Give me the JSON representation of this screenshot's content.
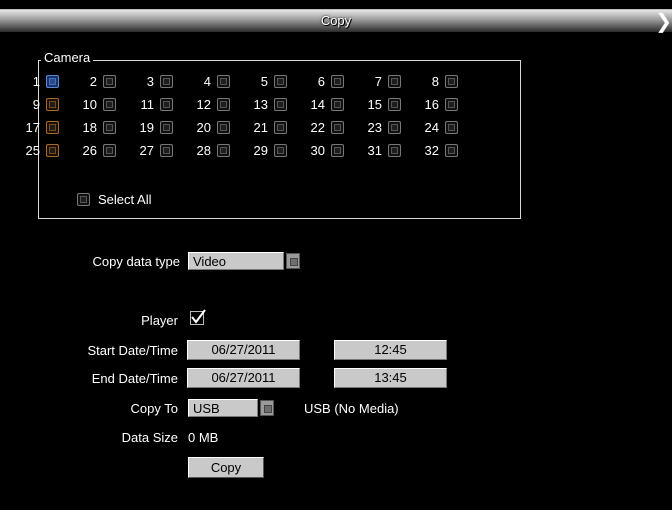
{
  "window": {
    "title": "Copy",
    "close_glyph": "❯"
  },
  "camera": {
    "legend": "Camera",
    "channels": [
      "1",
      "2",
      "3",
      "4",
      "5",
      "6",
      "7",
      "8",
      "9",
      "10",
      "11",
      "12",
      "13",
      "14",
      "15",
      "16",
      "17",
      "18",
      "19",
      "20",
      "21",
      "22",
      "23",
      "24",
      "25",
      "26",
      "27",
      "28",
      "29",
      "30",
      "31",
      "32"
    ],
    "select_all_label": "Select All"
  },
  "copy_data_type": {
    "label": "Copy data type",
    "value": "Video"
  },
  "player": {
    "label": "Player",
    "checked": true
  },
  "start": {
    "label": "Start Date/Time",
    "date": "06/27/2011",
    "time": "12:45"
  },
  "end": {
    "label": "End Date/Time",
    "date": "06/27/2011",
    "time": "13:45"
  },
  "copy_to": {
    "label": "Copy To",
    "value": "USB",
    "status": "USB (No Media)"
  },
  "data_size": {
    "label": "Data Size",
    "value": "0 MB"
  },
  "copy_button": {
    "label": "Copy"
  },
  "colors": {
    "background": "#000000",
    "field": "#c9c9c9",
    "selected_border": "#5a86d6",
    "alt_border": "#a96a2a"
  }
}
